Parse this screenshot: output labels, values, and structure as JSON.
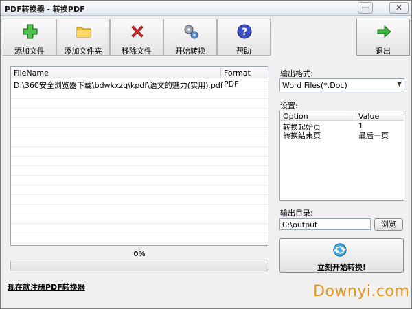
{
  "window": {
    "title": "PDF转换器 - 转换PDF",
    "min_label": "—",
    "close_label": "✕"
  },
  "toolbar": {
    "add_file": "添加文件",
    "add_folder": "添加文件夹",
    "remove_file": "移除文件",
    "start_convert": "开始转换",
    "help": "帮助",
    "exit": "退出"
  },
  "file_list": {
    "columns": [
      "FileName",
      "Format"
    ],
    "rows": [
      {
        "filename": "D:\\360安全浏览器下载\\bdwkxzq\\kpdf\\语文的魅力(实用).pdf",
        "format": "PDF"
      }
    ]
  },
  "progress": {
    "label": "0%",
    "value": 0,
    "fill_color": "#3cb043"
  },
  "register_link": "现在就注册PDF转换器",
  "output_format": {
    "label": "输出格式:",
    "selected": "Word Files(*.Doc)"
  },
  "settings": {
    "label": "设置:",
    "columns": [
      "Option",
      "Value"
    ],
    "rows": [
      {
        "option": "转换起始页",
        "value": "1"
      },
      {
        "option": "转换结束页",
        "value": "最后一页"
      }
    ]
  },
  "output_dir": {
    "label": "输出目录:",
    "value": "C:\\output",
    "browse_label": "浏览"
  },
  "start_button": "立刻开始转换!",
  "watermark": "Downyi.com"
}
